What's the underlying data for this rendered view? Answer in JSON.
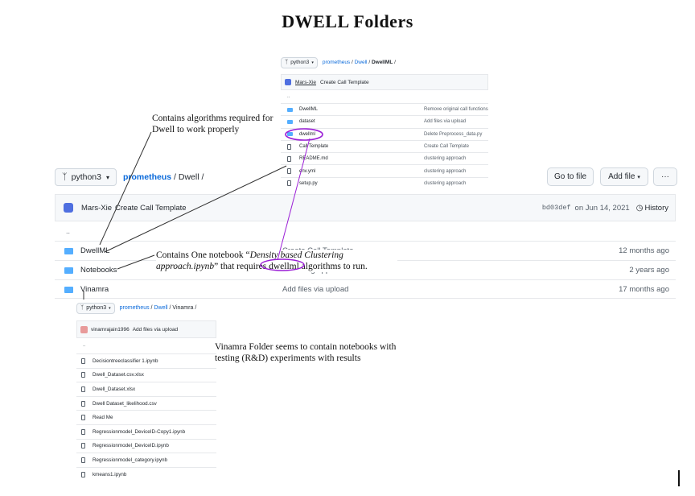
{
  "title": "DWELL Folders",
  "colors": {
    "link": "#0969da",
    "folder": "#54aeff",
    "annotation_line": "#333333",
    "highlight": "#9b1fd6"
  },
  "top_shot": {
    "branch": "python3",
    "crumbs": {
      "repo": "prometheus",
      "sep1": " / ",
      "dir": "Dwell",
      "sep2": " / ",
      "current": "DwellML",
      "sep3": " /"
    },
    "commit": {
      "author": "Mars-Xie",
      "message": "Create Call Template"
    },
    "parent": "..",
    "items": [
      {
        "name": "DwellML",
        "type": "folder",
        "msg": "Remove original call functions"
      },
      {
        "name": "dataset",
        "type": "folder",
        "msg": "Add files via upload"
      },
      {
        "name": "dwellml",
        "type": "folder",
        "msg": "Delete Preprocess_data.py"
      },
      {
        "name": "Call Template",
        "type": "file",
        "msg": "Create Call Template"
      },
      {
        "name": "README.md",
        "type": "file",
        "msg": "clustering approach"
      },
      {
        "name": "env.yml",
        "type": "file",
        "msg": "clustering approach"
      },
      {
        "name": "setup.py",
        "type": "file",
        "msg": "clustering approach"
      }
    ]
  },
  "main": {
    "branch": "python3",
    "crumbs": {
      "repo": "prometheus",
      "sep1": " / ",
      "dir": "Dwell",
      "sep2": " /"
    },
    "go_to_file": "Go to file",
    "add_file": "Add file",
    "more": "···",
    "commit": {
      "author": "Mars-Xie",
      "message": "Create Call Template",
      "hash": "bd03def",
      "date": "on Jun 14, 2021",
      "history": "History"
    },
    "parent": "..",
    "rows": [
      {
        "name": "DwellML",
        "msg": "Create Call Template",
        "age": "12 months ago"
      },
      {
        "name": "Notebooks",
        "msg": "clustering approach",
        "age": "2 years ago"
      },
      {
        "name": "Vinamra",
        "msg": "Add files via upload",
        "age": "17 months ago"
      }
    ]
  },
  "bottom_shot": {
    "branch": "python3",
    "crumbs": {
      "repo": "prometheus",
      "sep1": " / ",
      "dir": "Dwell",
      "sep2": " / ",
      "current": "Vinamra",
      "sep3": " /"
    },
    "commit": {
      "author": "vinamrajain1996",
      "message": "Add files via upload"
    },
    "parent": "..",
    "items": [
      {
        "name": "Decisiontreeclassifier 1.ipynb"
      },
      {
        "name": "Dwell_Dataset.csv.xlsx"
      },
      {
        "name": "Dwell_Dataset.xlsx"
      },
      {
        "name": "Dwell Dataset_likelihood.csv"
      },
      {
        "name": "Read Me"
      },
      {
        "name": "Regressionmodel_DeviceID-Copy1.ipynb"
      },
      {
        "name": "Regressionmodel_DeviceID.ipynb"
      },
      {
        "name": "Regressionmodel_category.ipynb"
      },
      {
        "name": "kmeans1.ipynb"
      }
    ]
  },
  "annotations": {
    "dwellml": {
      "line1": "Contains algorithms required for",
      "line2": "Dwell to work properly"
    },
    "notebooks": {
      "line1_pre": "Contains One notebook “",
      "line1_em": "Density based Clustering",
      "line2_em": "approach.ipynb",
      "line2_mid": "” that requires ",
      "line2_hl": "dwellml",
      "line2_post": " algorithms to run."
    },
    "vinamra": {
      "line1": "Vinamra Folder seems to contain notebooks with",
      "line2": "testing (R&D) experiments with results"
    }
  }
}
